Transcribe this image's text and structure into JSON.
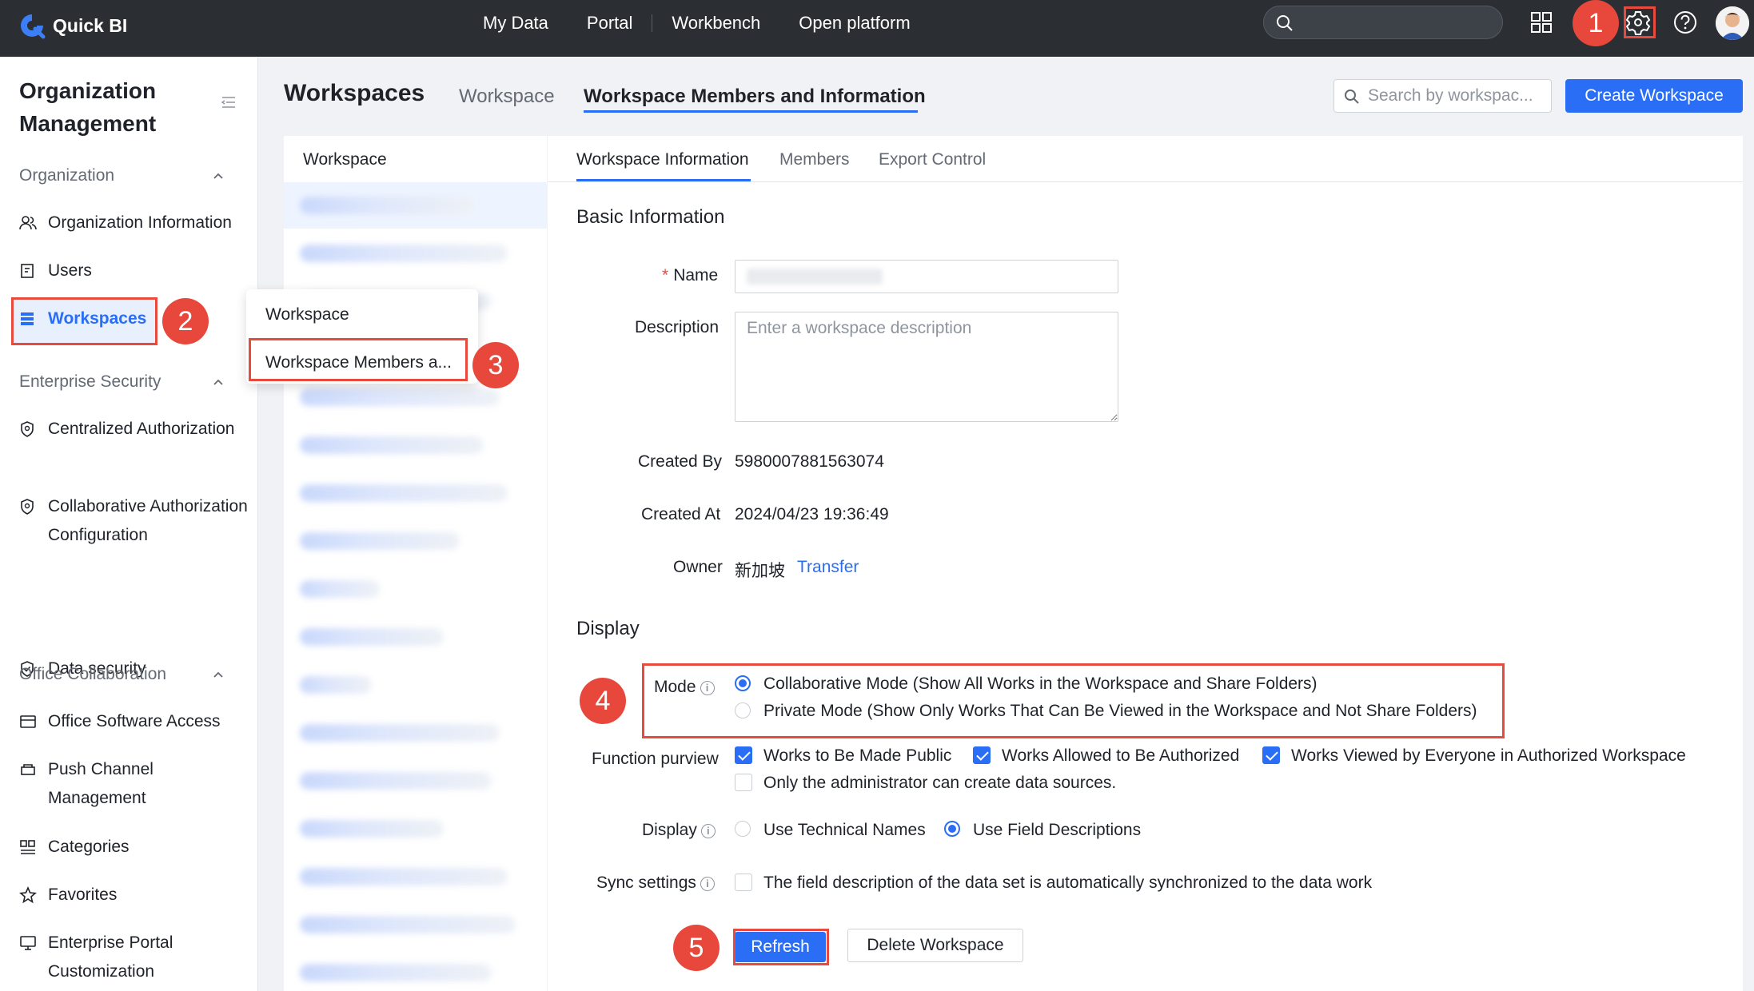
{
  "app": {
    "logo_text": "Quick BI"
  },
  "nav": {
    "items": [
      "My Data",
      "Portal",
      "Workbench",
      "Open platform"
    ]
  },
  "steps": [
    "1",
    "2",
    "3",
    "4",
    "5"
  ],
  "sidebar": {
    "title": "Organization Management",
    "sections": {
      "organization": "Organization",
      "enterprise_security": "Enterprise Security",
      "office_collaboration": "Office Collaboration"
    },
    "items": {
      "org_info": "Organization Information",
      "users": "Users",
      "workspaces": "Workspaces",
      "centralized": "Centralized Authorization",
      "collaborative": "Collaborative Authorization Configuration",
      "data_security": "Data security",
      "office_software": "Office Software Access",
      "push_channel": "Push Channel Management",
      "categories": "Categories",
      "favorites": "Favorites",
      "portal_custom": "Enterprise Portal Customization"
    }
  },
  "dropdown": {
    "items": [
      "Workspace",
      "Workspace Members a..."
    ]
  },
  "main": {
    "title": "Workspaces",
    "tabs": [
      "Workspace",
      "Workspace Members and Information"
    ],
    "search_placeholder": "Search by workspac...",
    "create_button": "Create Workspace"
  },
  "ws_list": {
    "header": "Workspace"
  },
  "detail": {
    "tabs": [
      "Workspace Information",
      "Members",
      "Export Control"
    ],
    "basic_title": "Basic Information",
    "name_label": "Name",
    "required_mark": "*",
    "description_label": "Description",
    "description_placeholder": "Enter a workspace description",
    "created_by_label": "Created By",
    "created_by": "5980007881563074",
    "created_at_label": "Created At",
    "created_at": "2024/04/23 19:36:49",
    "owner_label": "Owner",
    "owner": "新加坡",
    "transfer_link": "Transfer",
    "display_title": "Display",
    "mode_label": "Mode",
    "mode_options": [
      "Collaborative Mode (Show All Works in the Workspace and Share Folders)",
      "Private Mode (Show Only Works That Can Be Viewed in the Workspace and Not Share Folders)"
    ],
    "function_label": "Function purview",
    "function_options": [
      "Works to Be Made Public",
      "Works Allowed to Be Authorized",
      "Works Viewed by Everyone in Authorized Workspace",
      "Only the administrator can create data sources."
    ],
    "display_label": "Display",
    "display_options": [
      "Use Technical Names",
      "Use Field Descriptions"
    ],
    "sync_label": "Sync settings",
    "sync_option": "The field description of the data set is automatically synchronized to the data work",
    "info_glyph": "i",
    "refresh_button": "Refresh",
    "delete_button": "Delete Workspace"
  },
  "colors": {
    "primary": "#2a6ef5",
    "topbar": "#2b2e33",
    "highlight": "#e84a3d"
  }
}
